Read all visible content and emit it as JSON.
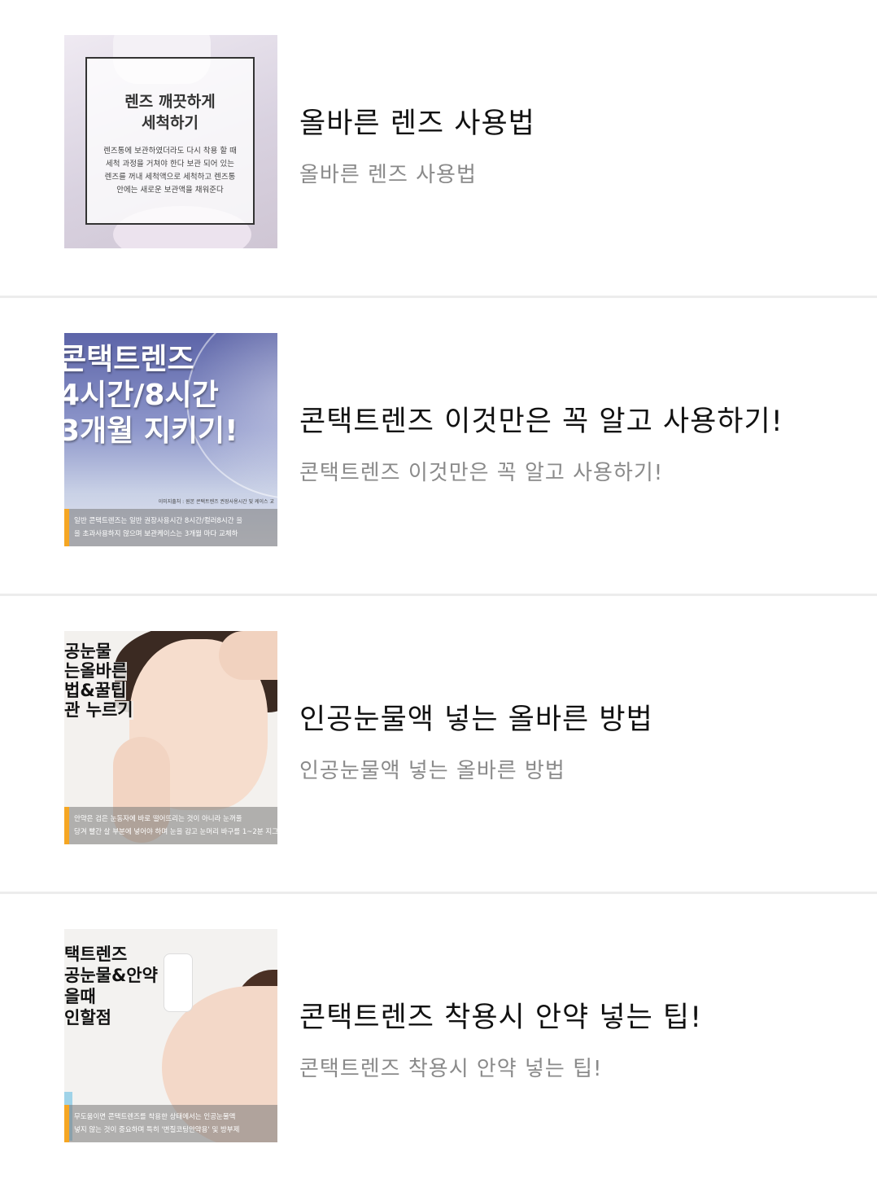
{
  "items": [
    {
      "title": "올바른 렌즈 사용법",
      "subtitle": "올바른 렌즈 사용법",
      "thumb": {
        "heading_line1": "렌즈 깨끗하게",
        "heading_line2": "세척하기",
        "body_lines": [
          "렌즈통에 보관하였더라도 다시 착용 할 때",
          "세척 과정을 거쳐야 한다 보관 되어 있는",
          "렌즈를 꺼내 세척액으로 세척하고 렌즈통",
          "안에는 새로운 보관액을 채워준다"
        ]
      }
    },
    {
      "title": "콘택트렌즈 이것만은 꼭 알고 사용하기!",
      "subtitle": "콘택트렌즈 이것만은 꼭 알고 사용하기!",
      "thumb": {
        "line1": "콘택트렌즈",
        "line2": "4시간/8시간",
        "line3": "3개월 지키기!",
        "small": "이미지출처 : 원본 콘택트렌즈 권장사용시간 및 케이스 교",
        "band_line1": "일반 콘택트렌즈는 일반 권장사용시간 8시간/컬러8시간 을",
        "band_line2": "을 초과사용하지 않으며 보관케이스는 3개월 마다 교체하"
      }
    },
    {
      "title": "인공눈물액 넣는 올바른 방법",
      "subtitle": "인공눈물액 넣는 올바른 방법",
      "thumb": {
        "line1": "공눈물",
        "line2": "는올바른",
        "line3": "법&꿀팁",
        "line4": "관 누르기",
        "band_line1": "안약은 검은 눈동자에 바로 떨어뜨리는 것이 아니라 눈꺼풀",
        "band_line2": "당겨 빨간 살 부분에 넣어야 하며 눈을 감고 눈머리 바구를 1~2분 지그"
      }
    },
    {
      "title": "콘택트렌즈 착용시 안약 넣는 팁!",
      "subtitle": "콘택트렌즈 착용시 안약 넣는 팁!",
      "thumb": {
        "line1": "택트렌즈",
        "line2": "공눈물&안약",
        "line3": "을때",
        "line4": "인할점",
        "band_line1": "무도움이면 콘택트렌즈를 착용한 상태에서는 인공눈물액",
        "band_line2": "넣지 않는 것이 중요하며 특히 '변질코팅안약용' 및 방부제"
      }
    }
  ]
}
